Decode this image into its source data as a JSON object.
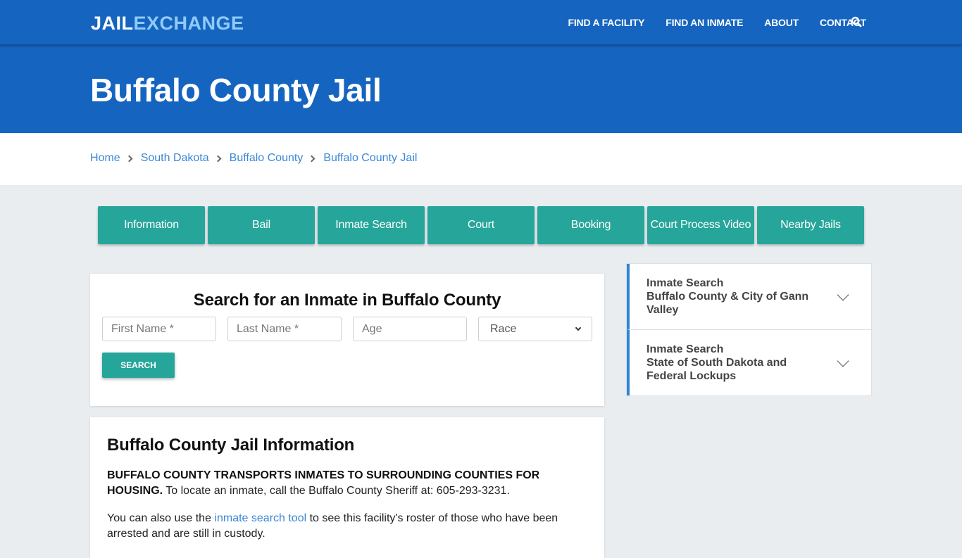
{
  "navbar": {
    "logo_part1": "JAIL",
    "logo_part2": "EXCHANGE",
    "links": [
      "FIND A FACILITY",
      "FIND AN INMATE",
      "ABOUT",
      "CONTACT"
    ],
    "search_icon": "search-icon"
  },
  "hero": {
    "title": "Buffalo County Jail"
  },
  "breadcrumb": [
    "Home",
    "South Dakota",
    "Buffalo County",
    "Buffalo County Jail"
  ],
  "tabs": [
    "Information",
    "Bail",
    "Inmate Search",
    "Court",
    "Booking",
    "Court Process Video",
    "Nearby Jails"
  ],
  "search_form": {
    "title": "Search for an Inmate in Buffalo County",
    "first_name_placeholder": "First Name *",
    "last_name_placeholder": "Last Name *",
    "age_placeholder": "Age",
    "race_selected": "Race",
    "button_label": "SEARCH"
  },
  "info": {
    "title": "Buffalo County Jail Information",
    "p1_bold": "BUFFALO COUNTY TRANSPORTS INMATES TO SURROUNDING COUNTIES FOR HOUSING.",
    "p1_rest": " To locate an inmate, call the Buffalo County Sheriff at: 605-293-3231.",
    "p2_before": "You can also use the ",
    "p2_link": "inmate search tool",
    "p2_after": " to see this facility's roster of those who have been arrested and are still in custody."
  },
  "sidebar": {
    "items": [
      {
        "line1": "Inmate Search",
        "line2": "Buffalo County & City of Gann Valley"
      },
      {
        "line1": "Inmate Search",
        "line2": "State of South Dakota and Federal Lockups"
      }
    ]
  },
  "colors": {
    "primary_blue": "#1565c0",
    "logo_accent": "#90caf9",
    "teal": "#26a69a",
    "link_blue": "#3a87d4",
    "page_bg": "#e9edf0"
  }
}
